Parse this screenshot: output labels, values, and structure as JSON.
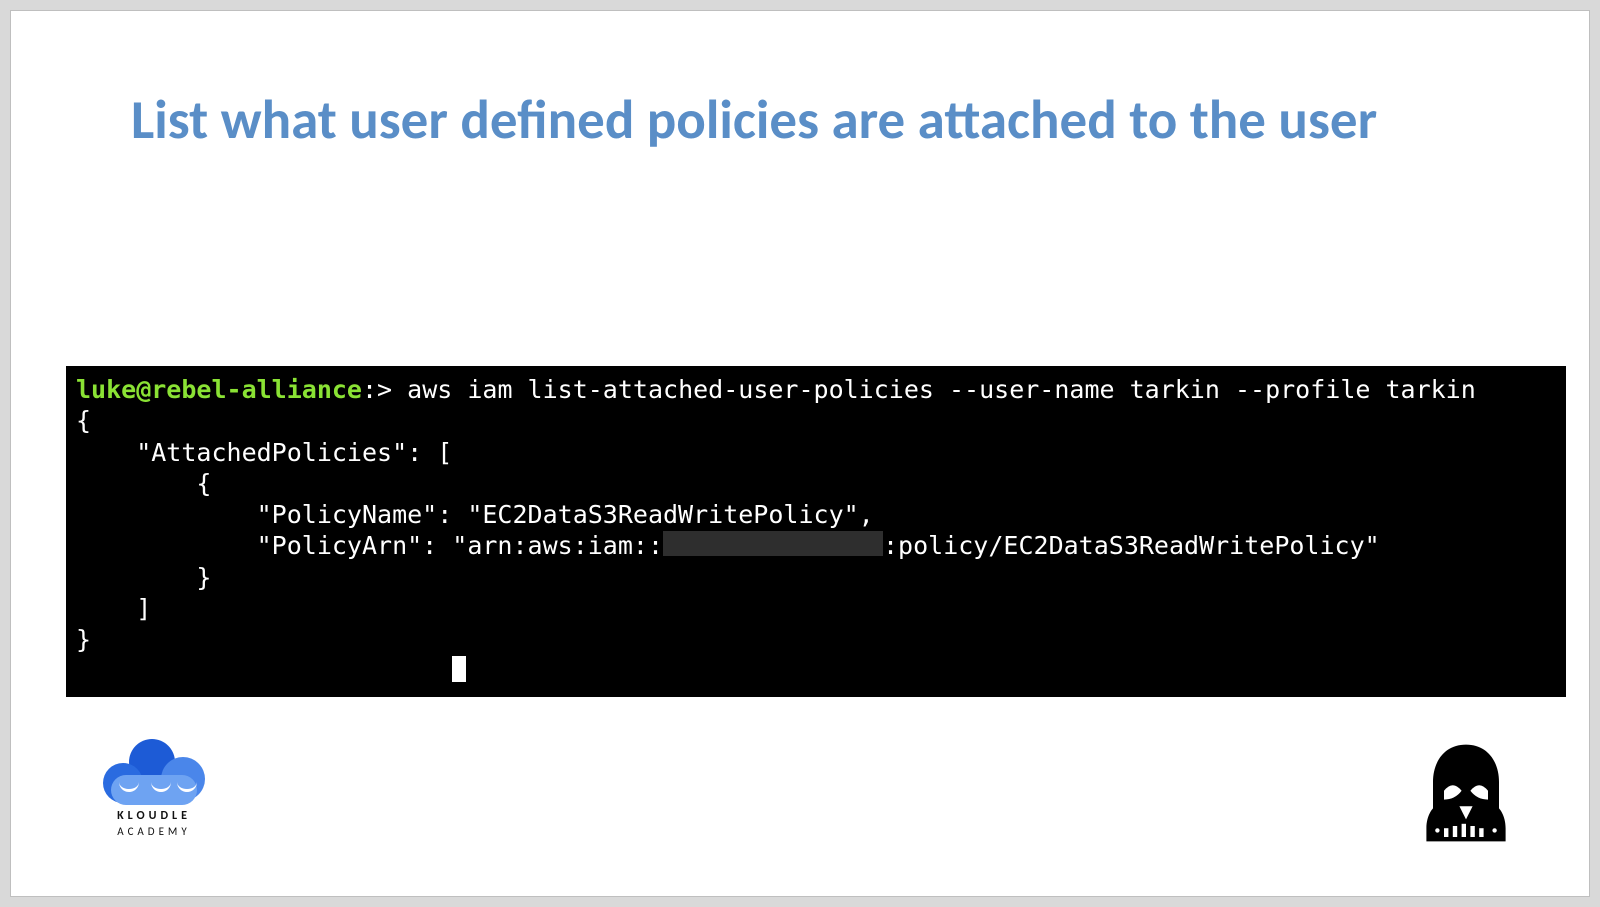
{
  "title": "List what user defined policies are attached to the user",
  "terminal": {
    "prompt_user": "luke@rebel-alliance",
    "prompt_sep": ":>",
    "command": " aws iam list-attached-user-policies --user-name tarkin --profile tarkin",
    "out_line1": "{",
    "out_line2": "    \"AttachedPolicies\": [",
    "out_line3": "        {",
    "out_line4": "            \"PolicyName\": \"EC2DataS3ReadWritePolicy\",",
    "out_line5_a": "            \"PolicyArn\": \"arn:aws:iam::",
    "out_line5_b": ":policy/EC2DataS3ReadWritePolicy\"",
    "out_line6": "        }",
    "out_line7": "    ]",
    "out_line8": "}"
  },
  "logo": {
    "line1": "KLOUDLE",
    "line2": "ACADEMY"
  },
  "icons": {
    "vader": "darth-vader-icon",
    "cloud": "kloudle-cloud-icon"
  }
}
